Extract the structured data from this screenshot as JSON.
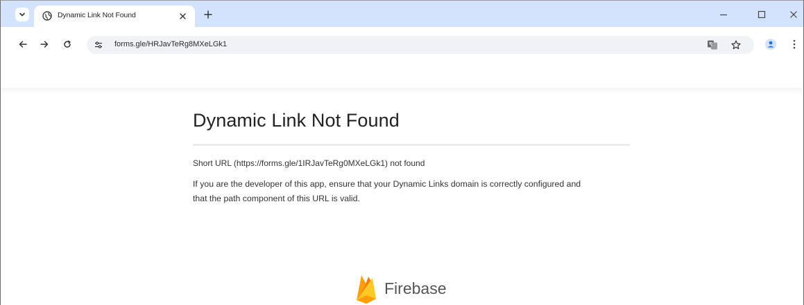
{
  "browser": {
    "tab": {
      "title": "Dynamic Link Not Found"
    },
    "address_bar": {
      "url": "forms.gle/HRJavTeRg8MXeLGk1"
    }
  },
  "page": {
    "title": "Dynamic Link Not Found",
    "short_url_message": "Short URL (https://forms.gle/1IRJavTeRg0MXeLGk1) not found",
    "explanation": "If you are the developer of this app, ensure that your Dynamic Links domain is correctly configured and that the path component of this URL is valid.",
    "brand_name": "Firebase"
  },
  "colors": {
    "tabstrip_background": "#d3e3fd",
    "omnibox_background": "#f0f2f6",
    "profile_accent": "#1a73e8",
    "firebase_yellow": "#ffca28",
    "firebase_orange": "#f57c00"
  },
  "icons": {
    "tab_search": "chevron-down-icon",
    "tab_favicon": "globe-icon",
    "tab_close": "close-icon",
    "new_tab": "plus-icon",
    "back": "arrow-left-icon",
    "forward": "arrow-right-icon",
    "reload": "reload-icon",
    "site_info": "tune-icon",
    "translate": "translate-icon",
    "bookmark": "star-icon",
    "profile": "person-icon",
    "menu": "more-vertical-icon",
    "minimize": "minimize-icon",
    "maximize": "maximize-icon",
    "close_window": "close-icon",
    "brand_logo": "firebase-logo"
  }
}
